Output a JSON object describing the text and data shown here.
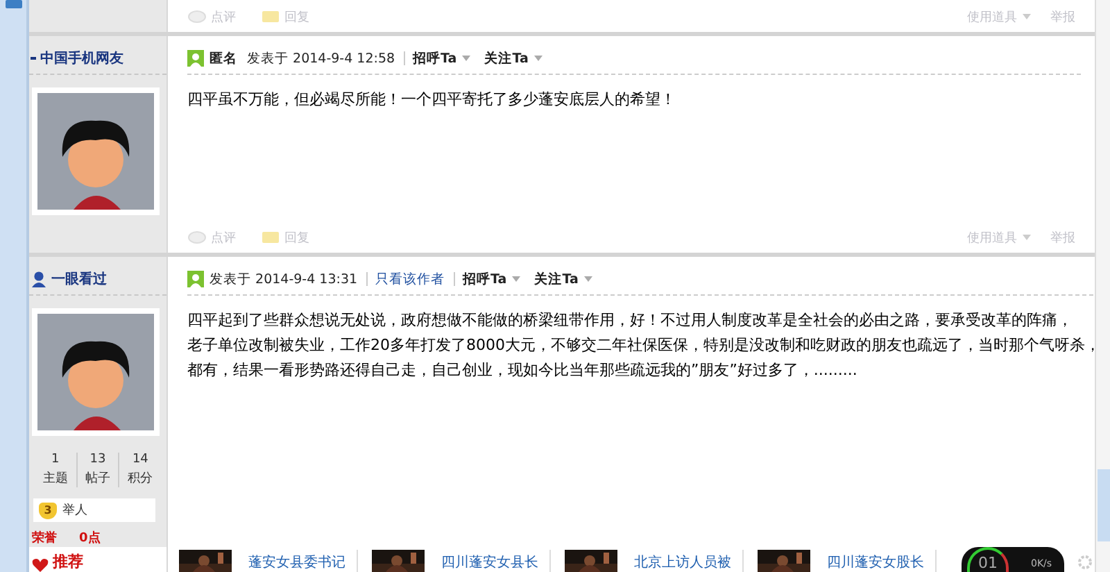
{
  "top_footer": {
    "actions": [
      "点评",
      "回复"
    ],
    "tools": "使用道具",
    "report": "举报"
  },
  "posts": [
    {
      "author": "中国手机网友",
      "author_online": false,
      "anonymous": "匿名",
      "posted": "发表于 2014-9-4 12:58",
      "greet": "招呼Ta",
      "follow": "关注Ta",
      "lines": [
        "四平虽不万能，但必竭尽所能！一个四平寄托了多少蓬安底层人的希望！"
      ],
      "footer": {
        "actions": [
          "点评",
          "回复"
        ],
        "tools": "使用道具",
        "report": "举报"
      }
    },
    {
      "author": "一眼看过",
      "author_online": true,
      "posted": "发表于 2014-9-4 13:31",
      "only_author": "只看该作者",
      "greet": "招呼Ta",
      "follow": "关注Ta",
      "lines": [
        "四平起到了些群众想说无处说，政府想做不能做的桥梁纽带作用，好！不过用人制度改革是全社会的必由之路，要承受改革的阵痛，",
        "老子单位改制被失业，工作20多年打发了8000大元，不够交二年社保医保，特别是没改制和吃财政的朋友也疏远了，当时那个气呀杀，",
        "都有，结果一看形势路还得自己走，自己创业，现如今比当年那些疏远我的”朋友”好过多了，........."
      ],
      "stats": [
        {
          "value": "1",
          "label": "主题"
        },
        {
          "value": "13",
          "label": "帖子"
        },
        {
          "value": "14",
          "label": "积分"
        }
      ],
      "rank_badge": "3",
      "rank": "举人",
      "honor_label": "荣誉",
      "honor_value": "0点"
    }
  ],
  "recommend": {
    "label": "推荐",
    "items": [
      "蓬安女县委书记",
      "四川蓬安女县长",
      "北京上访人员被",
      "四川蓬安女股长"
    ]
  },
  "widget": {
    "number": "01",
    "speed": "0K/s"
  }
}
